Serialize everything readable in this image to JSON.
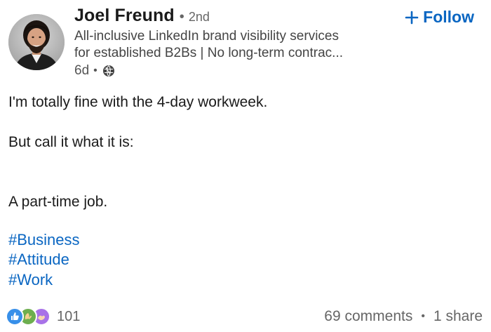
{
  "author": {
    "name": "Joel Freund",
    "degree": "2nd",
    "headline_line1": "All-inclusive LinkedIn brand visibility services",
    "headline_line2": "for established B2Bs | No long-term contrac...",
    "time": "6d",
    "visibility_icon": "globe-icon"
  },
  "follow": {
    "label": "Follow",
    "icon": "plus-icon",
    "color": "#0a66c2"
  },
  "post": {
    "lines": [
      "I'm totally fine with the 4-day workweek.",
      "But call it what it is:",
      "A part-time job."
    ],
    "hashtags": [
      "#Business",
      "#Attitude",
      "#Work"
    ]
  },
  "social": {
    "reaction_icons": [
      "like-icon",
      "celebrate-icon",
      "support-icon"
    ],
    "reactions_count": "101",
    "comments": "69 comments",
    "shares": "1 share"
  }
}
